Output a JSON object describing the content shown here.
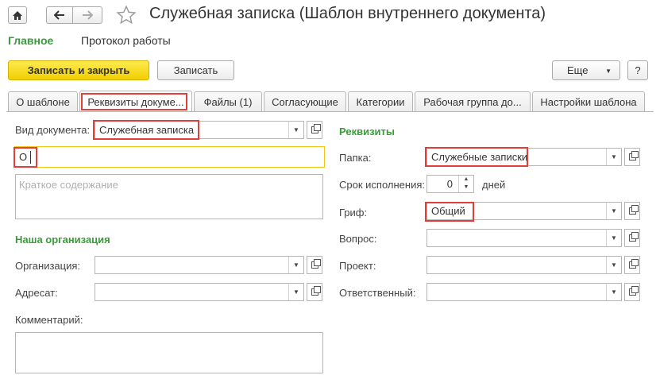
{
  "window": {
    "title": "Служебная записка (Шаблон внутреннего документа)"
  },
  "toolbar_icons": {
    "home": "home-icon",
    "back": "arrow-left-icon",
    "forward": "arrow-right-icon",
    "favorite": "star-icon"
  },
  "nav": {
    "main": "Главное",
    "log": "Протокол работы"
  },
  "commands": {
    "save_close": "Записать и закрыть",
    "save": "Записать",
    "more": "Еще",
    "help": "?"
  },
  "tabs": [
    {
      "label": "О шаблоне"
    },
    {
      "label": "Реквизиты докуме..."
    },
    {
      "label": "Файлы (1)"
    },
    {
      "label": "Согласующие"
    },
    {
      "label": "Категории"
    },
    {
      "label": "Рабочая группа до..."
    },
    {
      "label": "Настройки шаблона"
    }
  ],
  "left": {
    "doc_type_label": "Вид документа:",
    "doc_type_value": "Служебная записка",
    "subject_value": "О",
    "summary_placeholder": "Краткое содержание",
    "org_section": "Наша организация",
    "org_label": "Организация:",
    "addressee_label": "Адресат:",
    "comment_label": "Комментарий:"
  },
  "right": {
    "section": "Реквизиты",
    "folder_label": "Папка:",
    "folder_value": "Служебные записки",
    "deadline_label": "Срок исполнения:",
    "deadline_value": "0",
    "deadline_unit": "дней",
    "classification_label": "Гриф:",
    "classification_value": "Общий",
    "question_label": "Вопрос:",
    "project_label": "Проект:",
    "responsible_label": "Ответственный:"
  },
  "colors": {
    "accent_green": "#3a9b3a",
    "primary_yellow": "#f5d90a",
    "highlight_red": "#e0403a",
    "focus_yellow": "#f0c419"
  }
}
